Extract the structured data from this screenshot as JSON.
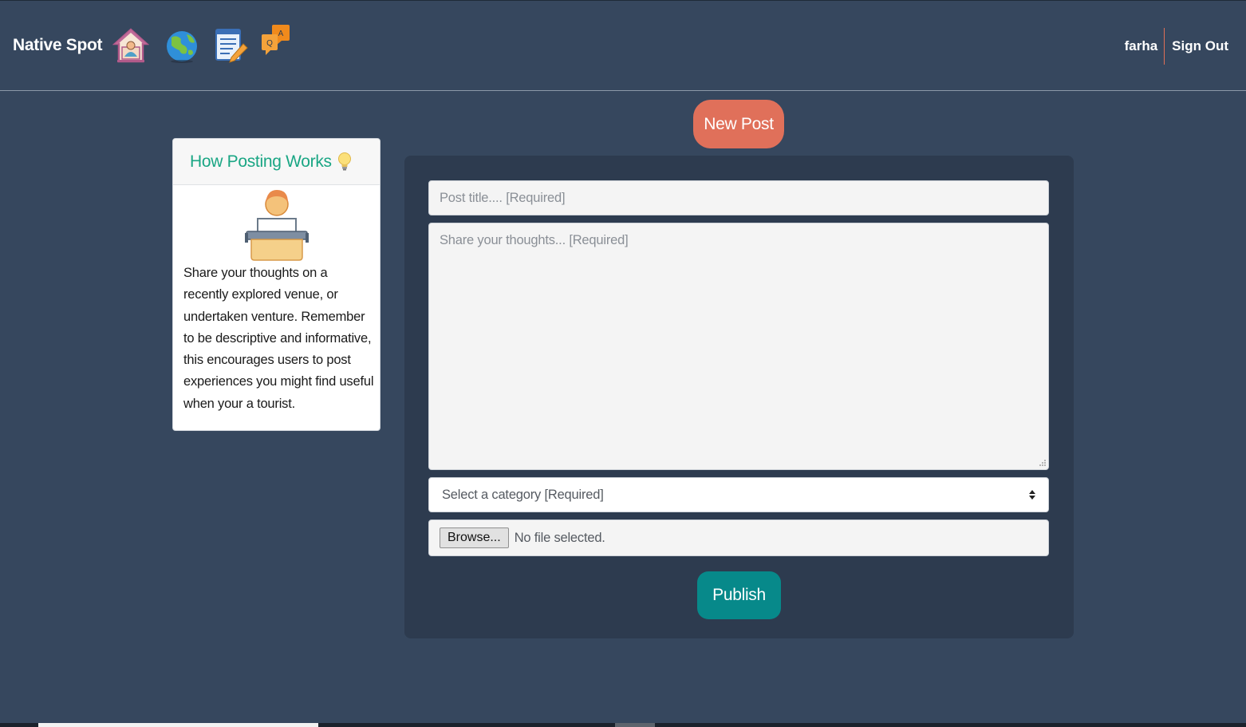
{
  "navbar": {
    "brand": "Native Spot",
    "icons": [
      "home-icon",
      "globe-icon",
      "edit-list-icon",
      "qa-chat-icon"
    ],
    "user_name": "farha",
    "sign_out": "Sign Out"
  },
  "new_post_label": "New Post",
  "info_card": {
    "title": "How Posting Works",
    "text": "Share your thoughts on a recently explored venue, or undertaken venture. Remember to be descriptive and informative, this encourages users to post experiences you might find useful when your a tourist."
  },
  "form": {
    "title_placeholder": "Post title.... [Required]",
    "body_placeholder": "Share your thoughts... [Required]",
    "category_selected": "Select a category [Required]",
    "browse_label": "Browse...",
    "file_status": "No file selected.",
    "publish_label": "Publish"
  },
  "colors": {
    "background": "#36475e",
    "panel": "#2d3b4f",
    "new_post": "#e0705a",
    "publish": "#07898a",
    "info_title": "#1aa684"
  }
}
